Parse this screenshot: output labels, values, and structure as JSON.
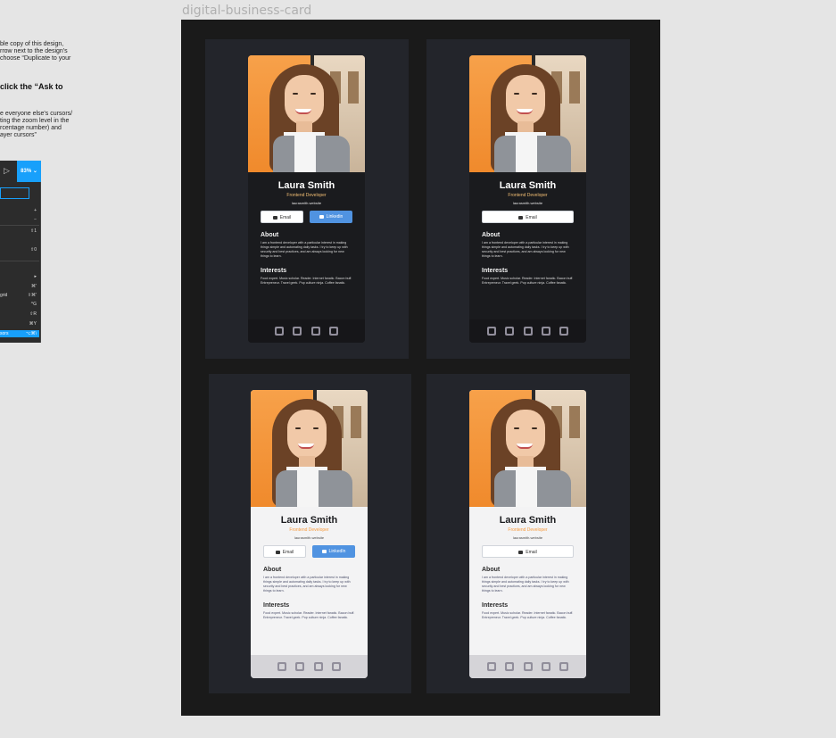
{
  "frame_title": "digital-business-card",
  "instructions": {
    "line1": "ble copy of this design,",
    "line2": "rrow next to the design's",
    "line3": "choose “Duplicate to your",
    "bold": "click the “Ask to",
    "line4": "e everyone else's cursors/",
    "line5": "ting the zoom level in the",
    "line6": "rcentage number) and",
    "line7": "ayer cursors”"
  },
  "toolbar": {
    "play_icon": "▷",
    "zoom": "83% ⌄"
  },
  "zoom_menu": {
    "items": [
      {
        "label": "",
        "shortcut": "+"
      },
      {
        "label": "",
        "shortcut": "−"
      },
      {
        "label": "",
        "shortcut": "⇧1"
      },
      {
        "label": "",
        "shortcut": "⇧0"
      },
      {
        "label": "",
        "shortcut": "▸"
      },
      {
        "label": "",
        "shortcut": "⌘'"
      },
      {
        "label": "grid",
        "shortcut": "⇧⌘'"
      },
      {
        "label": "",
        "shortcut": "^G"
      },
      {
        "label": "",
        "shortcut": "⇧R"
      },
      {
        "label": "",
        "shortcut": "⌘Y"
      },
      {
        "label": "sors",
        "shortcut": "⌥⌘\\"
      }
    ]
  },
  "cards": [
    {
      "theme": "dark",
      "name": "Laura Smith",
      "role": "Frontend Developer",
      "website": "laurasmith.website",
      "email_label": "Email",
      "linkedin_label": "Linkedin",
      "about_title": "About",
      "about_text": "I am a frontend developer with a particular interest in making things simple and automating daily tasks. I try to keep up with security and best practices, and am always looking for new things to learn.",
      "interests_title": "Interests",
      "interests_text": "Food expert. Music scholar. Reader. Internet fanatic. Bacon buff. Entrepreneur. Travel geek. Pop culture ninja. Coffee fanatic.",
      "social_icons": [
        "twitter-icon",
        "facebook-icon",
        "instagram-icon",
        "github-icon"
      ]
    },
    {
      "theme": "dark",
      "name": "Laura Smith",
      "role": "Frontend Developer",
      "website": "laurasmith.website",
      "email_label": "Email",
      "about_title": "About",
      "about_text": "I am a frontend developer with a particular interest in making things simple and automating daily tasks. I try to keep up with security and best practices, and am always looking for new things to learn.",
      "interests_title": "Interests",
      "interests_text": "Food expert. Music scholar. Reader. Internet fanatic. Bacon buff. Entrepreneur. Travel geek. Pop culture ninja. Coffee fanatic.",
      "social_icons": [
        "twitter-icon",
        "facebook-icon",
        "instagram-icon",
        "linkedin-icon",
        "github-icon"
      ]
    },
    {
      "theme": "light",
      "name": "Laura Smith",
      "role": "Frontend Developer",
      "website": "laurasmith.website",
      "email_label": "Email",
      "linkedin_label": "LinkedIn",
      "about_title": "About",
      "about_text": "I am a frontend developer with a particular interest in making things simple and automating daily tasks. I try to keep up with security and best practices, and am always looking for new things to learn.",
      "interests_title": "Interests",
      "interests_text": "Food expert. Music scholar. Reader. Internet fanatic. Bacon buff. Entrepreneur. Travel geek. Pop culture ninja. Coffee fanatic.",
      "social_icons": [
        "twitter-icon",
        "facebook-icon",
        "instagram-icon",
        "github-icon"
      ]
    },
    {
      "theme": "light",
      "name": "Laura Smith",
      "role": "Frontend Developer",
      "website": "laurasmith.website",
      "email_label": "Email",
      "about_title": "About",
      "about_text": "I am a frontend developer with a particular interest in making things simple and automating daily tasks. I try to keep up with security and best practices, and am always looking for new things to learn.",
      "interests_title": "Interests",
      "interests_text": "Food expert. Music scholar. Reader. Internet fanatic. Bacon buff. Entrepreneur. Travel geek. Pop culture ninja. Coffee fanatic.",
      "social_icons": [
        "twitter-icon",
        "facebook-icon",
        "instagram-icon",
        "linkedin-icon",
        "github-icon"
      ]
    }
  ],
  "colors": {
    "canvas": "#e5e5e5",
    "frame": "#1a1a1a",
    "cell": "#23252b",
    "accent_blue": "#5093e1",
    "role_orange": "#f3bf74",
    "figma_blue": "#18a0fb"
  }
}
